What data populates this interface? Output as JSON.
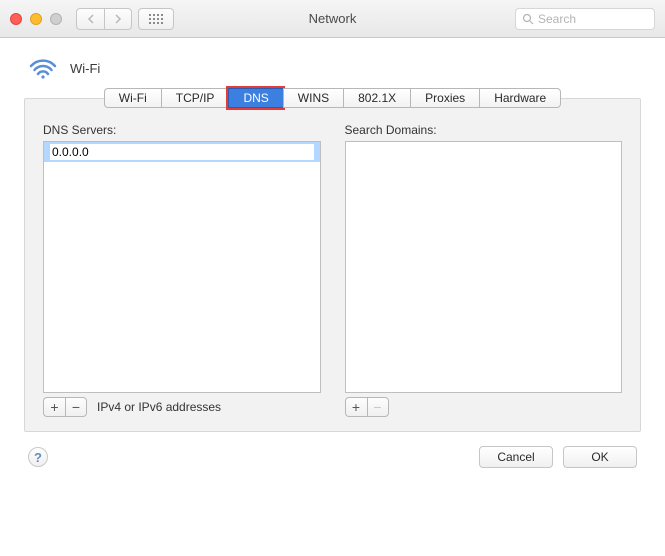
{
  "window": {
    "title": "Network"
  },
  "toolbar": {
    "search_placeholder": "Search"
  },
  "connection": {
    "name": "Wi-Fi"
  },
  "tabs": [
    {
      "label": "Wi-Fi",
      "active": false
    },
    {
      "label": "TCP/IP",
      "active": false
    },
    {
      "label": "DNS",
      "active": true
    },
    {
      "label": "WINS",
      "active": false
    },
    {
      "label": "802.1X",
      "active": false
    },
    {
      "label": "Proxies",
      "active": false
    },
    {
      "label": "Hardware",
      "active": false
    }
  ],
  "dns": {
    "label": "DNS Servers:",
    "entries": [
      "0.0.0.0"
    ],
    "editing_index": 0,
    "hint": "IPv4 or IPv6 addresses",
    "add_label": "+",
    "remove_label": "−",
    "remove_enabled": true
  },
  "search_domains": {
    "label": "Search Domains:",
    "entries": [],
    "add_label": "+",
    "remove_label": "−",
    "remove_enabled": false
  },
  "footer": {
    "help_label": "?",
    "cancel_label": "Cancel",
    "ok_label": "OK"
  }
}
